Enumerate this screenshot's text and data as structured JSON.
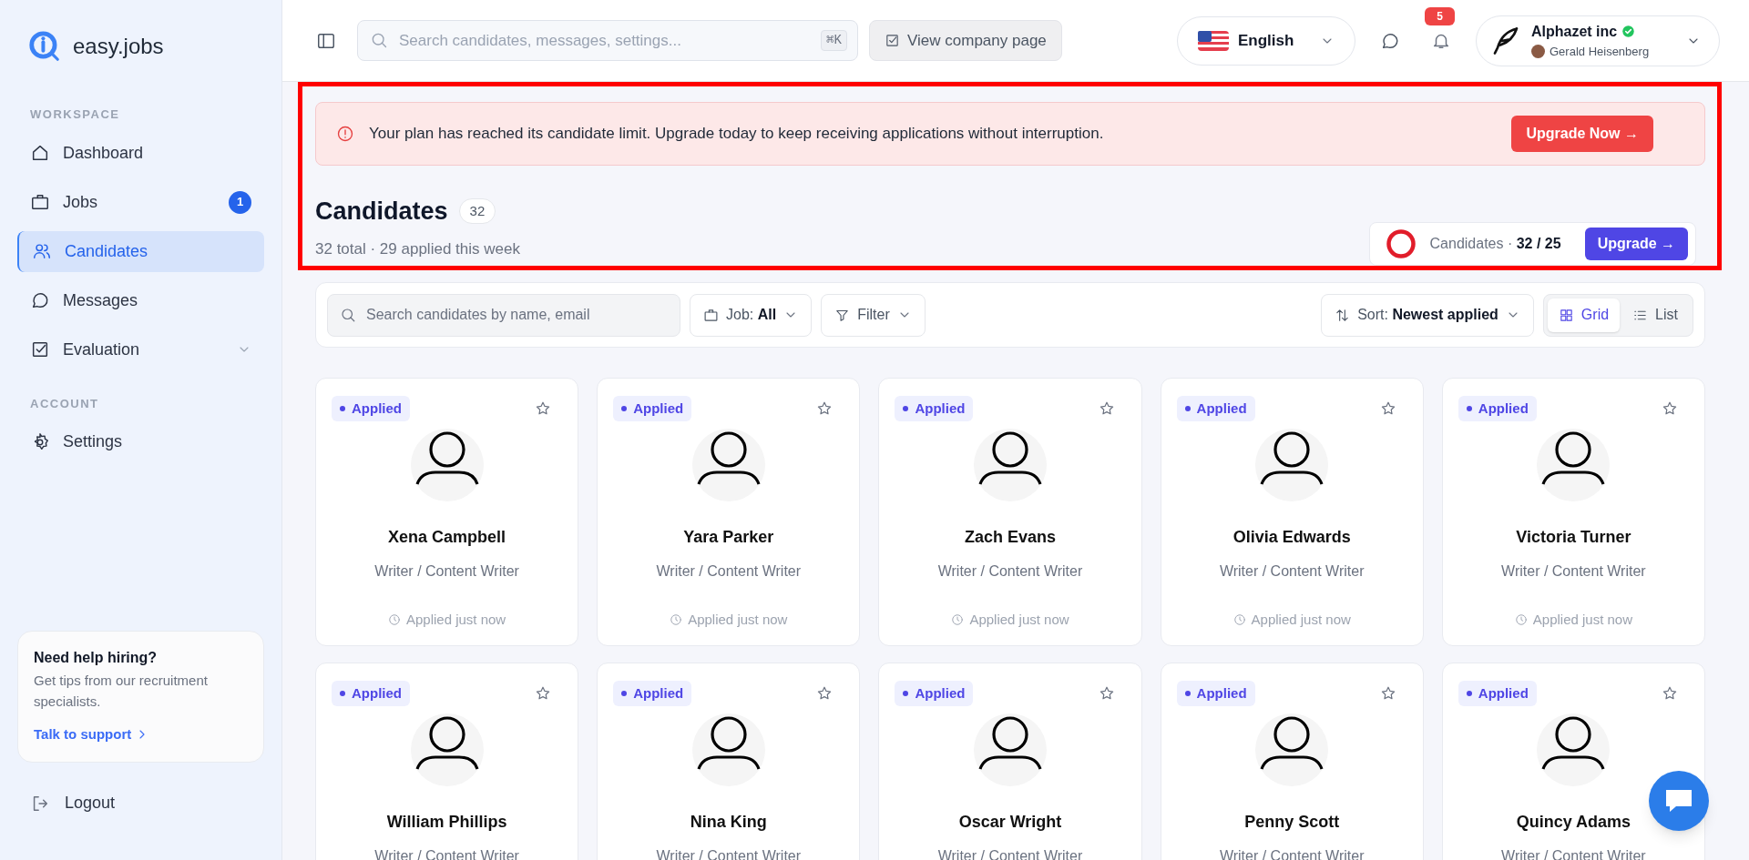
{
  "brand": {
    "name": "easy.jobs"
  },
  "sidebar": {
    "sections": [
      {
        "title": "WORKSPACE",
        "items": [
          {
            "label": "Dashboard",
            "selected": false
          },
          {
            "label": "Jobs",
            "selected": false,
            "badge": "1"
          },
          {
            "label": "Candidates",
            "selected": true
          },
          {
            "label": "Messages",
            "selected": false
          },
          {
            "label": "Evaluation",
            "selected": false,
            "expanded": false
          }
        ]
      },
      {
        "title": "ACCOUNT",
        "items": [
          {
            "label": "Settings",
            "selected": false
          }
        ]
      }
    ],
    "help_card": {
      "title": "Need help hiring?",
      "text": "Get tips from our recruitment specialists.",
      "link": "Talk to support"
    },
    "logout": "Logout"
  },
  "header": {
    "search": {
      "placeholder": "Search candidates, messages, settings...",
      "shortcut": "⌘K"
    },
    "company_button": "View company page",
    "language": "English",
    "notifications": "5",
    "account": {
      "company": "Alphazet inc",
      "user": "Gerald Heisenberg",
      "verified": true
    }
  },
  "alert": {
    "message": "Your plan has reached its candidate limit. Upgrade today to keep receiving applications without interruption.",
    "button": "Upgrade Now →"
  },
  "page": {
    "title": "Candidates",
    "count": "32",
    "subtitle": "32 total · 29 applied this week"
  },
  "usage": {
    "label": "Candidates ·",
    "value": "32 / 25",
    "button": "Upgrade →"
  },
  "toolbar": {
    "search_placeholder": "Search candidates by name, email",
    "job_label": "Job:",
    "job_value": "All",
    "filter": "Filter",
    "sort_label": "Sort:",
    "sort_value": "Newest applied",
    "views": [
      {
        "label": "Grid",
        "selected": true
      },
      {
        "label": "List",
        "selected": false
      }
    ]
  },
  "candidates": [
    {
      "status": "Applied",
      "name": "Xena Campbell",
      "role": "Writer / Content Writer",
      "applied": "Applied just now",
      "starred": false
    },
    {
      "status": "Applied",
      "name": "Yara Parker",
      "role": "Writer / Content Writer",
      "applied": "Applied just now",
      "starred": false
    },
    {
      "status": "Applied",
      "name": "Zach Evans",
      "role": "Writer / Content Writer",
      "applied": "Applied just now",
      "starred": false
    },
    {
      "status": "Applied",
      "name": "Olivia Edwards",
      "role": "Writer / Content Writer",
      "applied": "Applied just now",
      "starred": false
    },
    {
      "status": "Applied",
      "name": "Victoria Turner",
      "role": "Writer / Content Writer",
      "applied": "Applied just now",
      "starred": false
    },
    {
      "status": "Applied",
      "name": "William Phillips",
      "role": "Writer / Content Writer",
      "starred": false
    },
    {
      "status": "Applied",
      "name": "Nina King",
      "role": "Writer / Content Writer",
      "starred": false
    },
    {
      "status": "Applied",
      "name": "Oscar Wright",
      "role": "Writer / Content Writer",
      "starred": false
    },
    {
      "status": "Applied",
      "name": "Penny Scott",
      "role": "Writer / Content Writer",
      "starred": false
    },
    {
      "status": "Applied",
      "name": "Quincy Adams",
      "role": "Writer / Content Writer",
      "starred": false
    }
  ]
}
